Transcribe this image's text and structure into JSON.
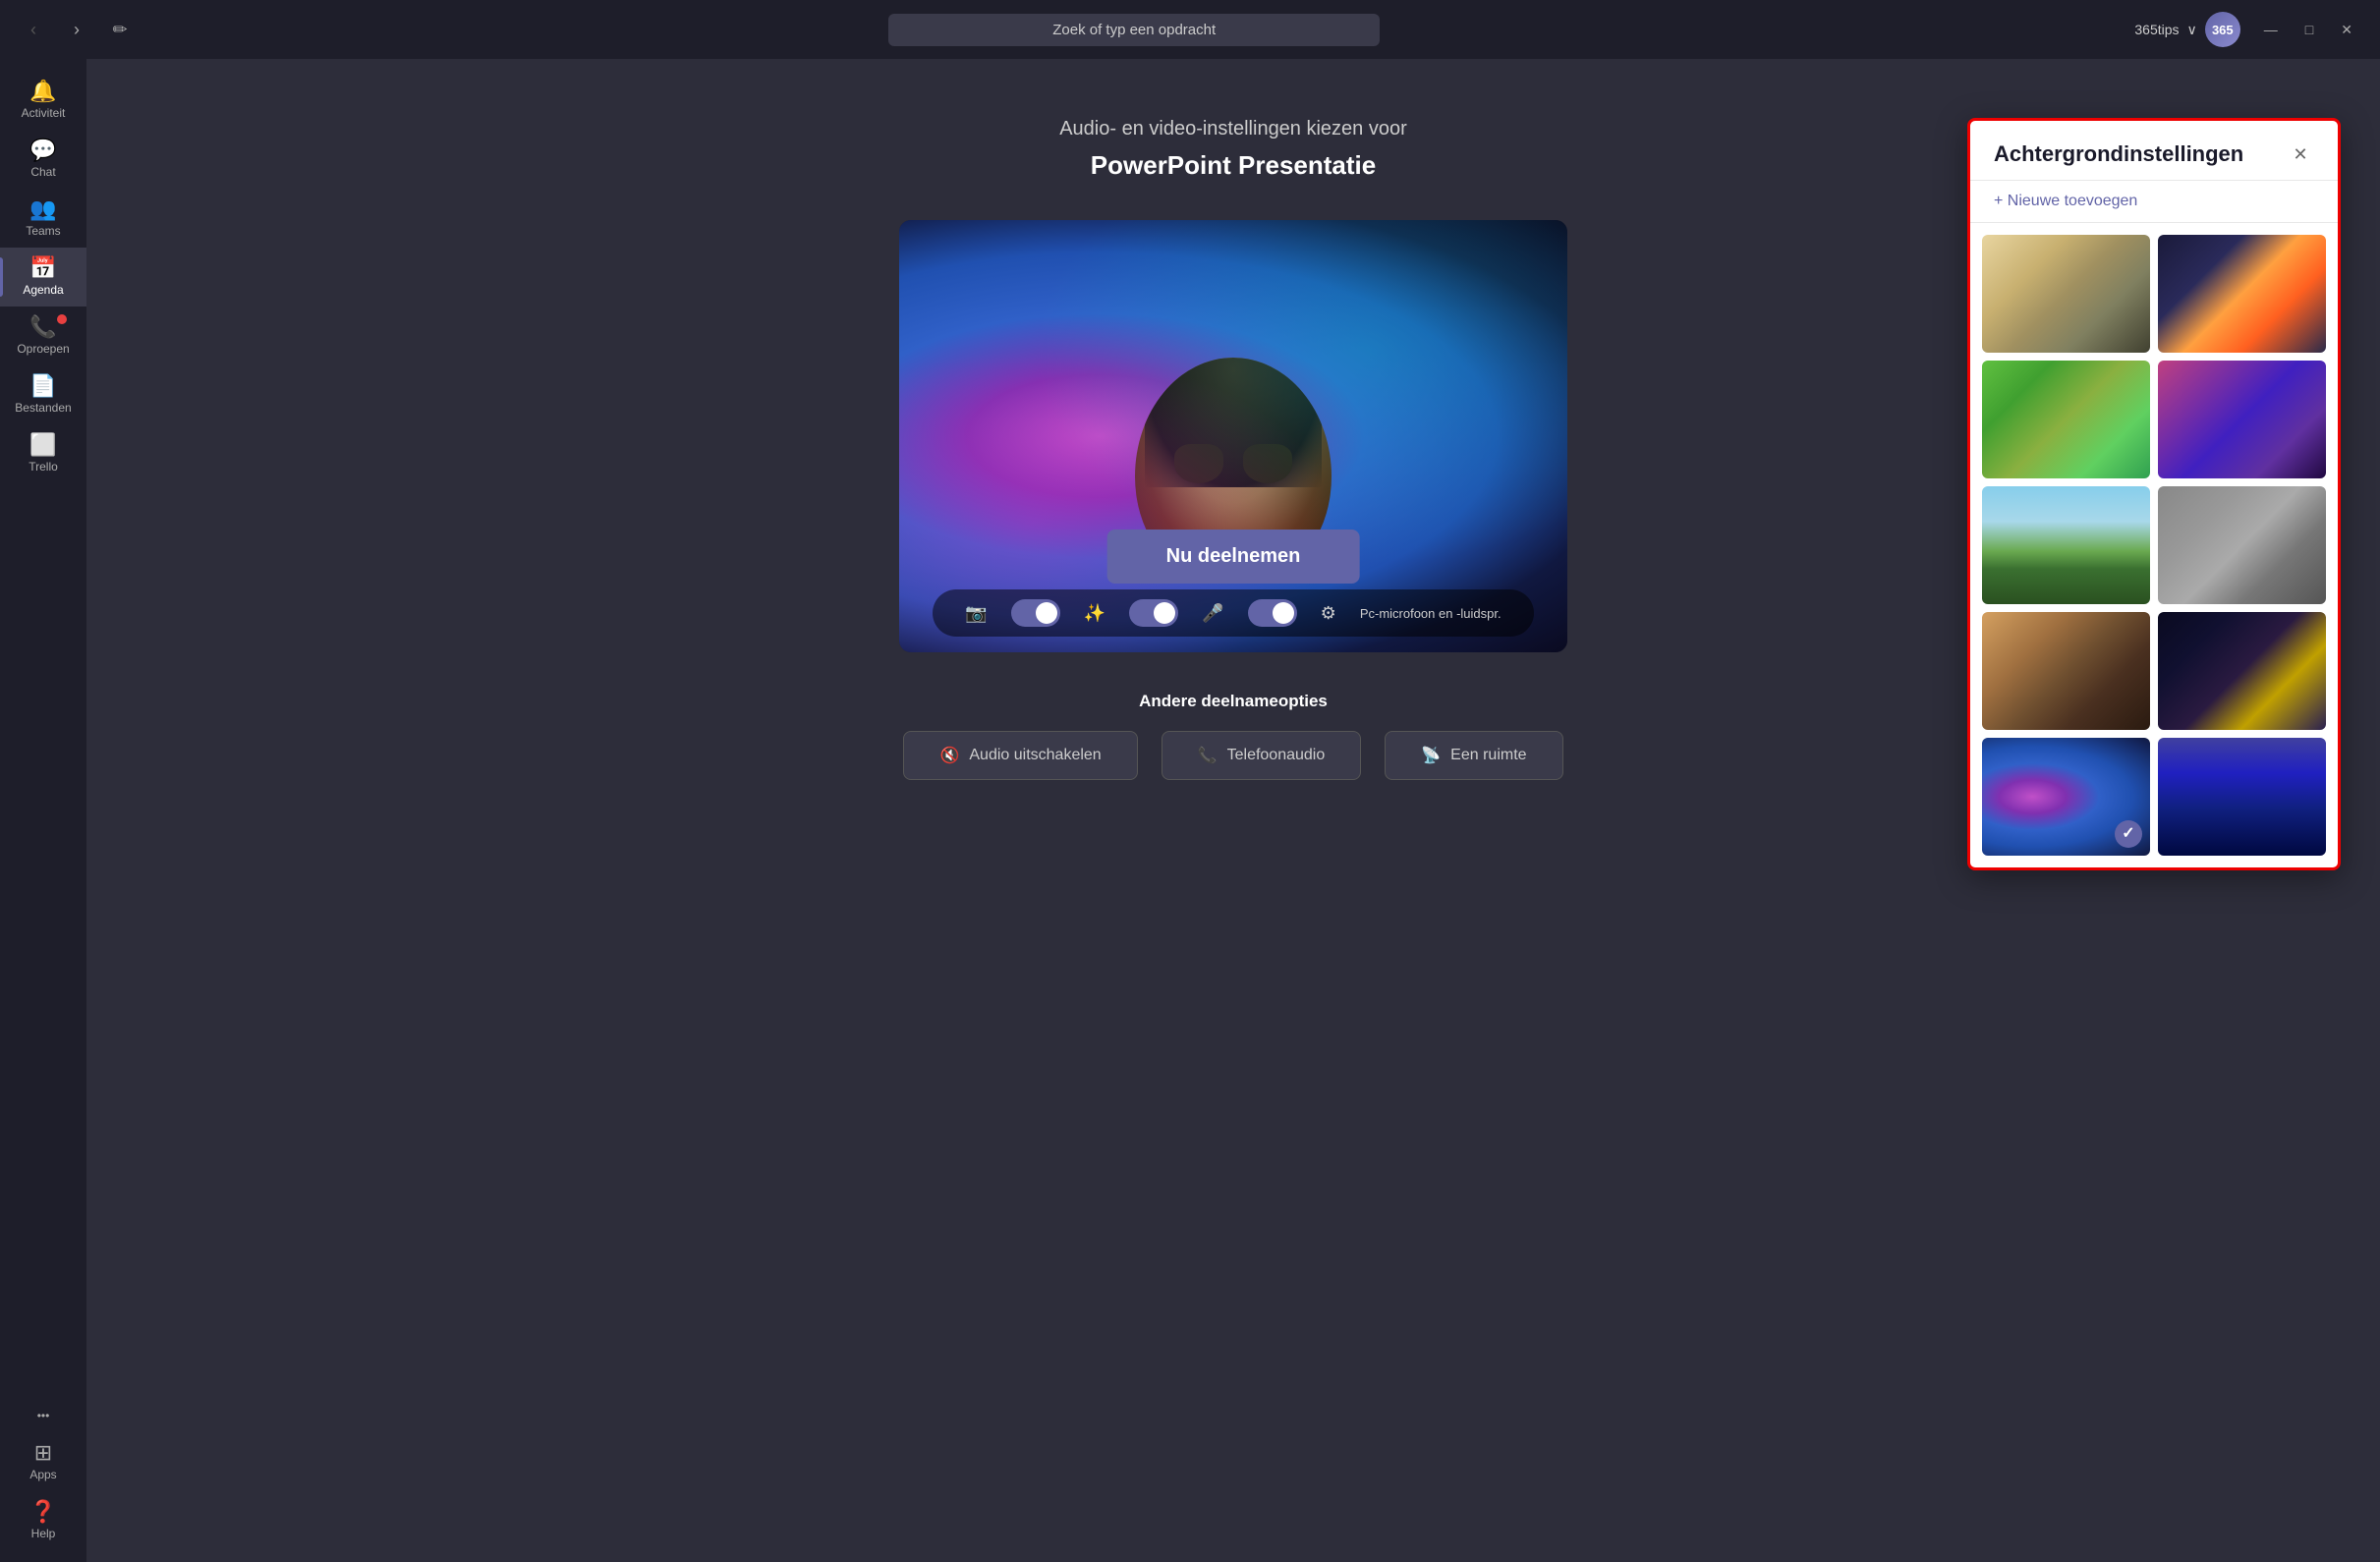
{
  "titlebar": {
    "search_placeholder": "Zoek of typ een opdracht",
    "user_name": "365tips",
    "user_chevron": "∨",
    "nav_back": "‹",
    "nav_forward": "›",
    "edit_icon": "✏",
    "minimize": "—",
    "maximize": "□",
    "close": "✕"
  },
  "sidebar": {
    "items": [
      {
        "id": "activiteit",
        "label": "Activiteit",
        "icon": "🔔",
        "active": false
      },
      {
        "id": "chat",
        "label": "Chat",
        "icon": "💬",
        "active": false
      },
      {
        "id": "teams",
        "label": "Teams",
        "icon": "👥",
        "active": false
      },
      {
        "id": "agenda",
        "label": "Agenda",
        "icon": "📅",
        "active": true
      },
      {
        "id": "oproepen",
        "label": "Oproepen",
        "icon": "📞",
        "active": false,
        "badge": true
      },
      {
        "id": "bestanden",
        "label": "Bestanden",
        "icon": "📄",
        "active": false
      },
      {
        "id": "trello",
        "label": "Trello",
        "icon": "⬜",
        "active": false
      }
    ],
    "bottom_items": [
      {
        "id": "apps",
        "label": "Apps",
        "icon": "⊞"
      },
      {
        "id": "help",
        "label": "Help",
        "icon": "❓"
      }
    ],
    "more": "•••"
  },
  "meeting": {
    "subtitle": "Audio- en video-instellingen kiezen voor",
    "title": "PowerPoint Presentatie",
    "join_button": "Nu deelnemen",
    "other_options_label": "Andere deelnameopties",
    "options": [
      {
        "id": "audio-off",
        "label": "Audio uitschakelen",
        "icon": "🔇"
      },
      {
        "id": "phone",
        "label": "Telefoonaudio",
        "icon": "📞"
      },
      {
        "id": "room",
        "label": "Een ruimte",
        "icon": "📡"
      }
    ],
    "controls": {
      "video_icon": "📷",
      "video_toggle": true,
      "effect_icon": "✨",
      "effect_toggle": true,
      "mic_icon": "🎤",
      "mic_toggle": true,
      "settings_icon": "⚙",
      "settings_label": "Pc-microfoon en -luidspr."
    }
  },
  "bg_panel": {
    "title": "Achtergrondinstellingen",
    "close_btn": "✕",
    "add_label": "+ Nieuwe toevoegen",
    "thumbnails": [
      {
        "id": "classroom",
        "class": "thumb-classroom",
        "selected": false
      },
      {
        "id": "scifi",
        "class": "thumb-scifi",
        "selected": false
      },
      {
        "id": "minecraft1",
        "class": "thumb-minecraft1",
        "selected": false
      },
      {
        "id": "minecraft2",
        "class": "thumb-minecraft2",
        "selected": false
      },
      {
        "id": "mountains",
        "class": "thumb-mountains",
        "selected": false
      },
      {
        "id": "ruins",
        "class": "thumb-ruins",
        "selected": false
      },
      {
        "id": "arch",
        "class": "thumb-arch",
        "selected": false
      },
      {
        "id": "space",
        "class": "thumb-space",
        "selected": false
      },
      {
        "id": "galaxy",
        "class": "thumb-galaxy",
        "selected": true
      },
      {
        "id": "fantasy",
        "class": "thumb-fantasy",
        "selected": false
      }
    ]
  }
}
